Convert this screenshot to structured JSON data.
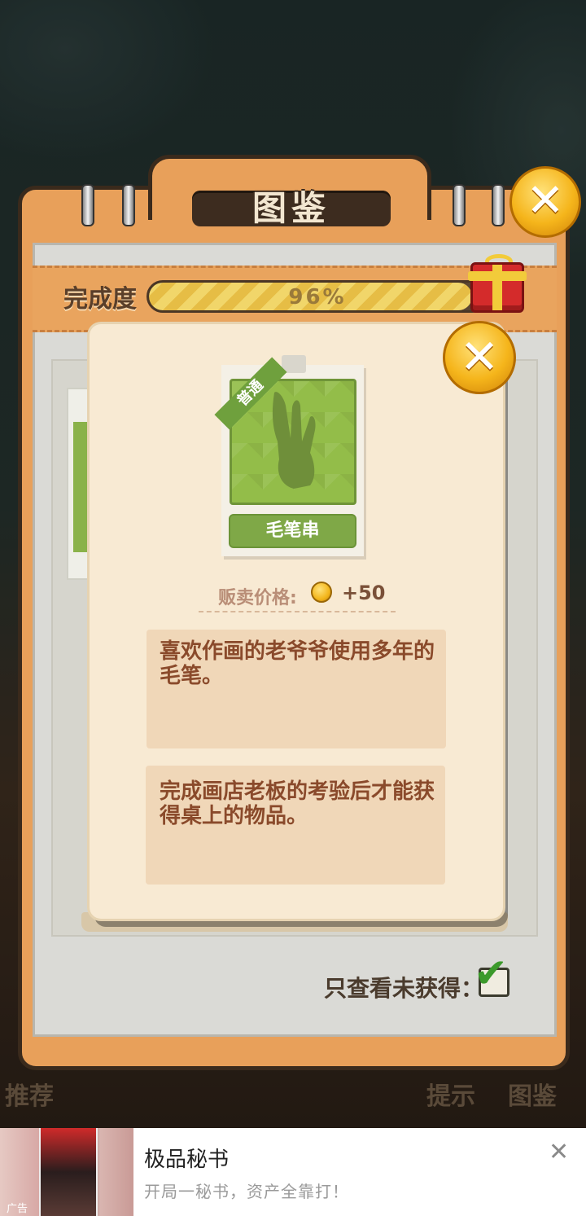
{
  "background": {
    "tabs": [
      "提示",
      "图鉴"
    ],
    "left_tab": "推荐"
  },
  "book": {
    "title": "图鉴",
    "progress_label": "完成度",
    "progress_value": "96%",
    "progress_fraction": 0.96,
    "filter_label": "只查看未获得："
  },
  "detail": {
    "rarity": "普通",
    "item_name": "毛笔串",
    "price_label": "贩卖价格:",
    "price_value": "+50",
    "description": "喜欢作画的老爷爷使用多年的毛笔。",
    "hint": "完成画店老板的考验后才能获得桌上的物品。"
  },
  "ad": {
    "tag": "广告",
    "title": "极品秘书",
    "subtitle": "开局一秘书，资产全靠打！"
  },
  "colors": {
    "book": "#e8a05a",
    "parchment": "#f8ead3",
    "item_green": "#93bd49",
    "text_brown": "#8a4a2b",
    "close_gold": "#f5b51b"
  }
}
